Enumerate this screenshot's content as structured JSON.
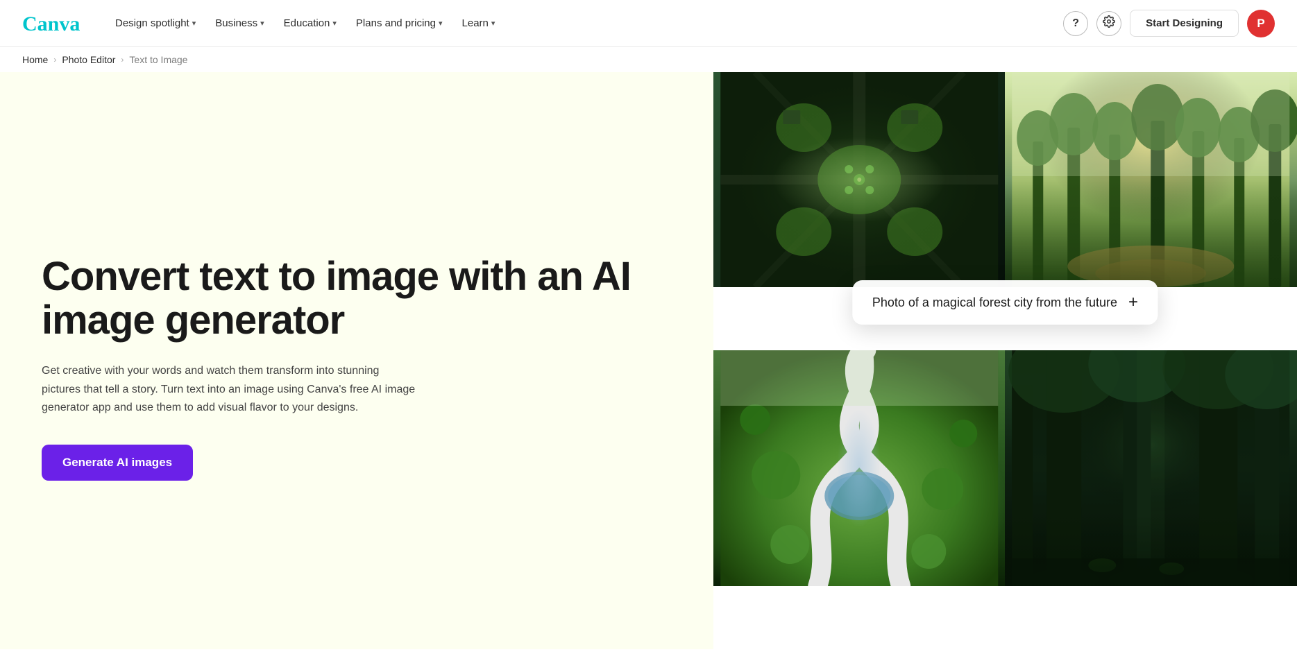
{
  "brand": {
    "name": "Canva",
    "logo_color": "#00c4cc"
  },
  "nav": {
    "links": [
      {
        "label": "Design spotlight",
        "has_dropdown": true
      },
      {
        "label": "Business",
        "has_dropdown": true
      },
      {
        "label": "Education",
        "has_dropdown": true
      },
      {
        "label": "Plans and pricing",
        "has_dropdown": true
      },
      {
        "label": "Learn",
        "has_dropdown": true
      }
    ],
    "help_icon": "?",
    "settings_icon": "⚙",
    "start_designing_label": "Start Designing",
    "avatar_initial": "P"
  },
  "breadcrumb": {
    "items": [
      {
        "label": "Home",
        "link": true
      },
      {
        "label": "Photo Editor",
        "link": true
      },
      {
        "label": "Text to Image",
        "link": false
      }
    ]
  },
  "hero": {
    "title": "Convert text to image with an AI image generator",
    "description": "Get creative with your words and watch them transform into stunning pictures that tell a story. Turn text into an image using Canva's free AI image generator app and use them to add visual flavor to your designs.",
    "cta_label": "Generate AI images"
  },
  "image_grid": {
    "prompt_text": "Photo of a magical forest city from the future",
    "prompt_plus": "+",
    "images": [
      {
        "id": "top-left",
        "alt": "Aerial view of green futuristic city"
      },
      {
        "id": "top-right",
        "alt": "Misty magical forest with golden light"
      },
      {
        "id": "bottom-left",
        "alt": "Winding roads through green landscape"
      },
      {
        "id": "bottom-right",
        "alt": "Dark mystical forest with tall trees"
      }
    ]
  }
}
